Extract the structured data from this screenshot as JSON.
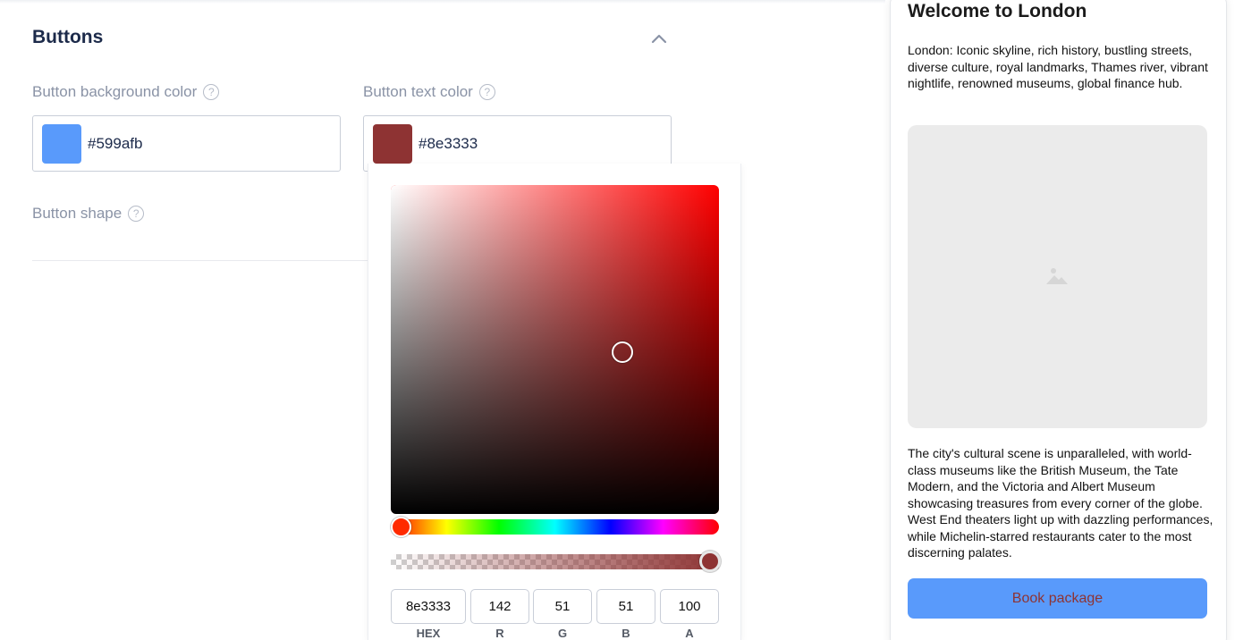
{
  "section": {
    "title": "Buttons",
    "collapse_icon": "chevron-up-icon"
  },
  "fields": {
    "bg_color": {
      "label": "Button background color",
      "help": "?",
      "value": "#599afb",
      "swatch_color": "#599afb"
    },
    "text_color": {
      "label": "Button text color",
      "help": "?",
      "value": "#8e3333",
      "swatch_color": "#8e3333"
    },
    "shape": {
      "label": "Button shape",
      "help": "?"
    }
  },
  "picker": {
    "hue_color": "#ff0000",
    "hex": {
      "value": "8e3333",
      "label": "HEX"
    },
    "r": {
      "value": "142",
      "label": "R"
    },
    "g": {
      "value": "51",
      "label": "G"
    },
    "b": {
      "value": "51",
      "label": "B"
    },
    "a": {
      "value": "100",
      "label": "A"
    }
  },
  "preview": {
    "title": "Welcome to London",
    "intro": "London: Iconic skyline, rich history, bustling streets, diverse culture, royal landmarks, Thames river, vibrant nightlife, renowned museums, global finance hub.",
    "image_icon": "image-placeholder-icon",
    "body": "The city's cultural scene is unparalleled, with world-class museums like the British Museum, the Tate Modern, and the Victoria and Albert Museum showcasing treasures from every corner of the globe. West End theaters light up with dazzling performances, while Michelin-starred restaurants cater to the most discerning palates.",
    "button_label": "Book package",
    "button_bg": "#599afb",
    "button_text_color": "#8e3333"
  }
}
